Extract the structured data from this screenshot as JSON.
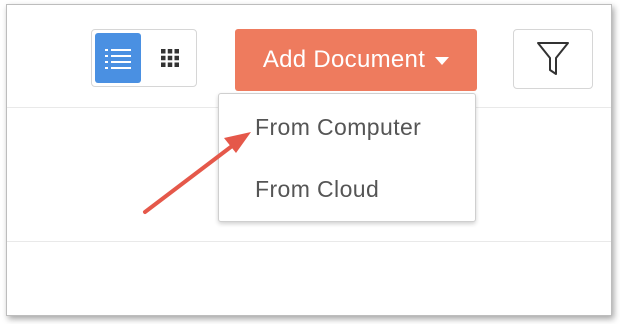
{
  "toolbar": {
    "view_toggle": {
      "selected": "list",
      "options": [
        {
          "name": "list",
          "icon": "list-view-icon"
        },
        {
          "name": "grid",
          "icon": "grid-view-icon"
        }
      ]
    },
    "add_document_label": "Add Document",
    "add_document_icon": "caret-down-icon",
    "filter_icon": "filter-funnel-icon"
  },
  "dropdown": {
    "items": [
      {
        "label": "From Computer"
      },
      {
        "label": "From Cloud"
      }
    ]
  },
  "annotation": {
    "type": "arrow",
    "points_to": "From Computer"
  },
  "colors": {
    "accent_orange": "#ee7b5e",
    "active_blue": "#4a90e2",
    "annotation_red": "#e5584a",
    "menu_text": "#555555"
  }
}
